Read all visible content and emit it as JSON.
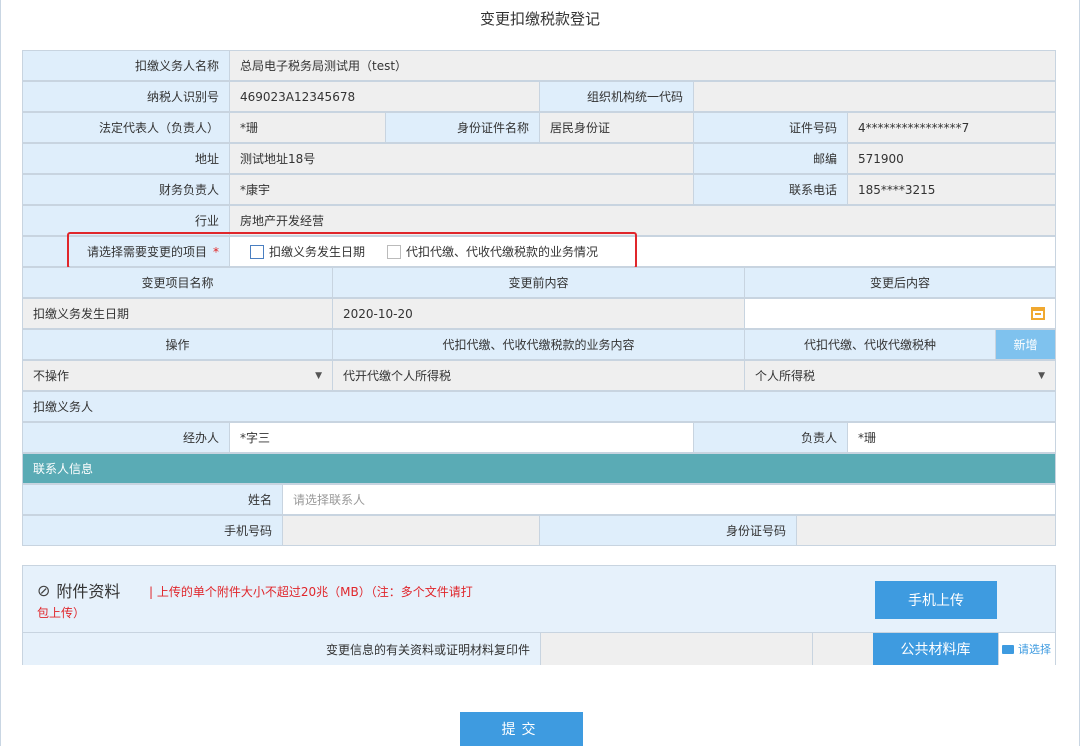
{
  "page_title": "变更扣缴税款登记",
  "basic": {
    "withholder_name_label": "扣缴义务人名称",
    "withholder_name": "总局电子税务局测试用（test）",
    "taxpayer_id_label": "纳税人识别号",
    "taxpayer_id": "469023A12345678",
    "org_code_label": "组织机构统一代码",
    "org_code": "",
    "legal_rep_label": "法定代表人（负责人）",
    "legal_rep": "*珊",
    "id_type_label": "身份证件名称",
    "id_type": "居民身份证",
    "id_no_label": "证件号码",
    "id_no": "4****************7",
    "address_label": "地址",
    "address": "测试地址18号",
    "postcode_label": "邮编",
    "postcode": "571900",
    "finance_label": "财务负责人",
    "finance": "*康宇",
    "phone_label": "联系电话",
    "phone": "185****3215",
    "industry_label": "行业",
    "industry": "房地产开发经营"
  },
  "change_select": {
    "label": "请选择需要变更的项目",
    "required_mark": "*",
    "options": [
      "扣缴义务发生日期",
      "代扣代缴、代收代缴税款的业务情况"
    ]
  },
  "change_table": {
    "headers": [
      "变更项目名称",
      "变更前内容",
      "变更后内容"
    ],
    "row": {
      "name": "扣缴义务发生日期",
      "before": "2020-10-20",
      "after": ""
    }
  },
  "ops_table": {
    "headers": [
      "操作",
      "代扣代缴、代收代缴税款的业务内容",
      "代扣代缴、代收代缴税种"
    ],
    "add_label": "新增",
    "row": {
      "operation": "不操作",
      "content": "代开代缴个人所得税",
      "tax_type": "个人所得税"
    }
  },
  "withholder_section": {
    "title": "扣缴义务人",
    "handler_label": "经办人",
    "handler": "*字三",
    "manager_label": "负责人",
    "manager": "*珊"
  },
  "contact": {
    "title": "联系人信息",
    "name_label": "姓名",
    "name_placeholder": "请选择联系人",
    "mobile_label": "手机号码",
    "mobile": "",
    "idcard_label": "身份证号码",
    "idcard": ""
  },
  "attachments": {
    "title": "附件资料",
    "note_line1": "| 上传的单个附件大小不超过20兆（MB）（注：多个文件请打",
    "note_line2": "包上传）",
    "mobile_upload": "手机上传",
    "public_library": "公共材料库",
    "file_label": "变更信息的有关资料或证明材料复印件",
    "browse": "请选择"
  },
  "submit_label": "提交"
}
